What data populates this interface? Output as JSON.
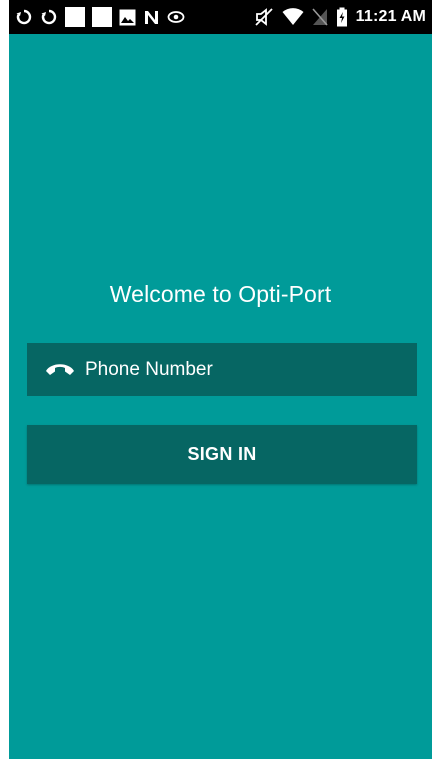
{
  "status_bar": {
    "time": "11:21 AM",
    "left_icons": [
      "sync-icon",
      "sync-icon",
      "blank-notification-icon",
      "blank-notification-icon",
      "image-icon",
      "n-icon",
      "eye-icon"
    ],
    "right_icons": [
      "mute-icon",
      "wifi-icon",
      "no-sim-icon",
      "battery-charging-icon"
    ]
  },
  "app": {
    "welcome_text": "Welcome to Opti-Port",
    "phone_field": {
      "placeholder": "Phone Number",
      "icon": "phone-icon"
    },
    "sign_in_label": "SIGN IN"
  },
  "colors": {
    "app_background": "#009b99",
    "field_background": "#066663",
    "status_bar_background": "#000000",
    "text": "#ffffff"
  }
}
